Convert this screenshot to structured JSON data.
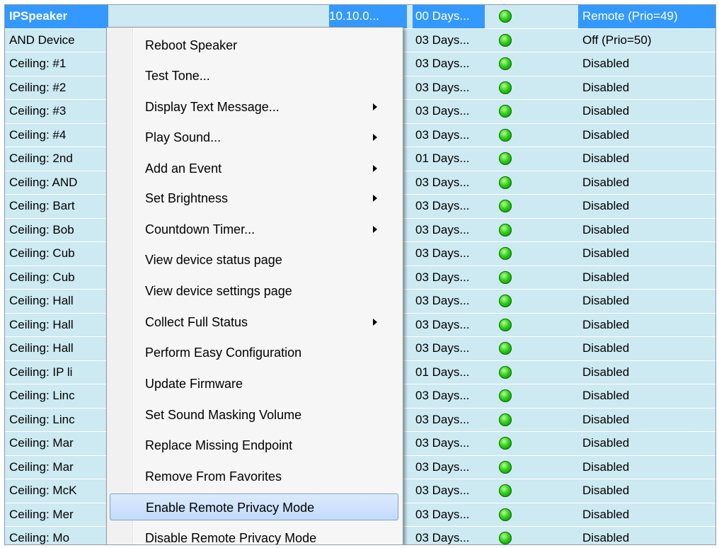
{
  "rows": [
    {
      "name": "IPSpeaker",
      "ip": "10.10.0...",
      "uptime": "00 Days...",
      "privacy": "Remote (Prio=49)"
    },
    {
      "name": "AND Device",
      "ip": "",
      "uptime": "03 Days...",
      "privacy": "Off (Prio=50)"
    },
    {
      "name": "Ceiling: #1",
      "ip": "",
      "uptime": "03 Days...",
      "privacy": "Disabled"
    },
    {
      "name": "Ceiling: #2",
      "ip": "",
      "uptime": "03 Days...",
      "privacy": "Disabled"
    },
    {
      "name": "Ceiling: #3",
      "ip": "",
      "uptime": "03 Days...",
      "privacy": "Disabled"
    },
    {
      "name": "Ceiling: #4",
      "ip": "",
      "uptime": "03 Days...",
      "privacy": "Disabled"
    },
    {
      "name": "Ceiling: 2nd",
      "ip": "",
      "uptime": "01 Days...",
      "privacy": "Disabled"
    },
    {
      "name": "Ceiling: AND",
      "ip": "",
      "uptime": "03 Days...",
      "privacy": "Disabled"
    },
    {
      "name": "Ceiling: Bart",
      "ip": "",
      "uptime": "03 Days...",
      "privacy": "Disabled"
    },
    {
      "name": "Ceiling: Bob",
      "ip": "",
      "uptime": "03 Days...",
      "privacy": "Disabled"
    },
    {
      "name": "Ceiling: Cub",
      "ip": "",
      "uptime": "03 Days...",
      "privacy": "Disabled"
    },
    {
      "name": "Ceiling: Cub",
      "ip": "",
      "uptime": "03 Days...",
      "privacy": "Disabled"
    },
    {
      "name": "Ceiling: Hall",
      "ip": "",
      "uptime": "03 Days...",
      "privacy": "Disabled"
    },
    {
      "name": "Ceiling: Hall",
      "ip": "",
      "uptime": "03 Days...",
      "privacy": "Disabled"
    },
    {
      "name": "Ceiling: Hall",
      "ip": "",
      "uptime": "03 Days...",
      "privacy": "Disabled"
    },
    {
      "name": "Ceiling: IP li",
      "ip": "",
      "uptime": "01 Days...",
      "privacy": "Disabled"
    },
    {
      "name": "Ceiling: Linc",
      "ip": "",
      "uptime": "03 Days...",
      "privacy": "Disabled"
    },
    {
      "name": "Ceiling: Linc",
      "ip": "",
      "uptime": "03 Days...",
      "privacy": "Disabled"
    },
    {
      "name": "Ceiling: Mar",
      "ip": "",
      "uptime": "03 Days...",
      "privacy": "Disabled"
    },
    {
      "name": "Ceiling: Mar",
      "ip": "",
      "uptime": "03 Days...",
      "privacy": "Disabled"
    },
    {
      "name": "Ceiling: McK",
      "ip": "",
      "uptime": "03 Days...",
      "privacy": "Disabled"
    },
    {
      "name": "Ceiling: Mer",
      "ip": "",
      "uptime": "03 Days...",
      "privacy": "Disabled"
    },
    {
      "name": "Ceiling: Mo",
      "ip": "",
      "uptime": "03 Days...",
      "privacy": "Disabled"
    }
  ],
  "context_menu": {
    "items": [
      {
        "label": "Reboot Speaker",
        "submenu": false,
        "highlighted": false
      },
      {
        "label": "Test Tone...",
        "submenu": false,
        "highlighted": false
      },
      {
        "label": "Display Text Message...",
        "submenu": true,
        "highlighted": false
      },
      {
        "label": "Play Sound...",
        "submenu": true,
        "highlighted": false
      },
      {
        "label": "Add an Event",
        "submenu": true,
        "highlighted": false
      },
      {
        "label": "Set Brightness",
        "submenu": true,
        "highlighted": false
      },
      {
        "label": "Countdown Timer...",
        "submenu": true,
        "highlighted": false
      },
      {
        "label": "View device status page",
        "submenu": false,
        "highlighted": false
      },
      {
        "label": "View device settings page",
        "submenu": false,
        "highlighted": false
      },
      {
        "label": "Collect Full Status",
        "submenu": true,
        "highlighted": false
      },
      {
        "label": "Perform Easy Configuration",
        "submenu": false,
        "highlighted": false
      },
      {
        "label": "Update Firmware",
        "submenu": false,
        "highlighted": false
      },
      {
        "label": "Set Sound Masking Volume",
        "submenu": false,
        "highlighted": false
      },
      {
        "label": "Replace Missing Endpoint",
        "submenu": false,
        "highlighted": false
      },
      {
        "label": "Remove From Favorites",
        "submenu": false,
        "highlighted": false
      },
      {
        "label": "Enable Remote Privacy Mode",
        "submenu": false,
        "highlighted": true
      },
      {
        "label": "Disable Remote Privacy Mode",
        "submenu": false,
        "highlighted": false
      }
    ]
  },
  "colors": {
    "row_background": "#cde9f1",
    "selection": "#3399ff",
    "status_online": "#34d31c",
    "menu_highlight": "#c1dbfc"
  },
  "icons": {
    "status": "green-led-icon",
    "submenu": "submenu-arrow-icon"
  }
}
